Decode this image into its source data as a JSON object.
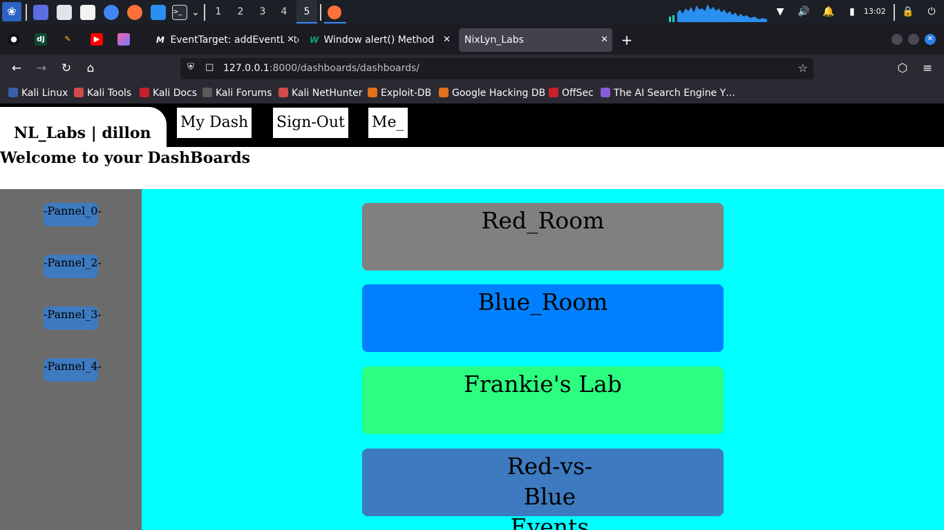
{
  "os_taskbar": {
    "workspaces": [
      "1",
      "2",
      "3",
      "4",
      "5"
    ],
    "active_workspace": "5",
    "clock": "13:02"
  },
  "browser": {
    "tabs": [
      {
        "label": "EventTarget: addEventListener",
        "favicon": "M"
      },
      {
        "label": "Window alert() Method",
        "favicon": "W"
      },
      {
        "label": "NixLyn_Labs",
        "favicon": ""
      }
    ],
    "active_tab": 2,
    "url_host": "127.0.0.1",
    "url_rest": ":8000/dashboards/dashboards/",
    "pinned_icons": [
      "github-icon",
      "django-icon",
      "pencil-icon",
      "youtube-icon",
      "gradient-app-icon"
    ],
    "bookmarks": [
      {
        "label": "Kali Linux",
        "color": "#3b5fa8"
      },
      {
        "label": "Kali Tools",
        "color": "#d04b4b"
      },
      {
        "label": "Kali Docs",
        "color": "#c8202a"
      },
      {
        "label": "Kali Forums",
        "color": "#5a5a5a"
      },
      {
        "label": "Kali NetHunter",
        "color": "#d04b4b"
      },
      {
        "label": "Exploit-DB",
        "color": "#e0701c"
      },
      {
        "label": "Google Hacking DB",
        "color": "#e0701c"
      },
      {
        "label": "OffSec",
        "color": "#c8202a"
      },
      {
        "label": "The AI Search Engine Y…",
        "color": "#8a5bd6"
      }
    ]
  },
  "site": {
    "brand": "NL_Labs | dillon",
    "nav": [
      "My Dash",
      "Sign-Out",
      "Me_"
    ],
    "welcome": "Welcome to your DashBoards",
    "pannels": [
      "-Pannel_0-",
      "-Pannel_2-",
      "-Pannel_3-",
      "-Pannel_4-"
    ],
    "rooms": [
      {
        "name": "Red_Room",
        "color": "#808080"
      },
      {
        "name": "Blue_Room",
        "color": "#0080ff"
      },
      {
        "name": "Frankie's Lab",
        "color": "#2cff80"
      },
      {
        "name": "Red-vs-Blue Events",
        "color": "#3d7abf"
      }
    ]
  },
  "colors": {
    "accent": "#3d8bfd",
    "sidebar": "#6b6b6b",
    "rooms_bg": "#00ffff",
    "pannel_button": "#3d7abf"
  }
}
